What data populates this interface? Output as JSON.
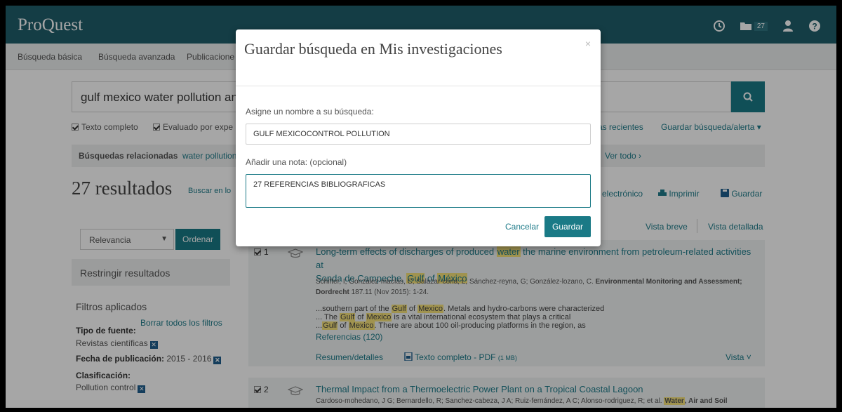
{
  "app": {
    "logo": "ProQuest",
    "folder_count": "27"
  },
  "colors": {
    "header": "#1f5f6b",
    "accent": "#1a7a86",
    "highlight": "#f6e27a"
  },
  "nav": {
    "items": [
      "Búsqueda básica",
      "Búsqueda avanzada",
      "Publicacione"
    ]
  },
  "search": {
    "query": "gulf mexico water pollution and"
  },
  "filters_row": {
    "full_text": "Texto completo",
    "peer_reviewed": "Evaluado por expe",
    "recent": "as recientes",
    "save_search": "Guardar búsqueda/alerta ▾"
  },
  "related": {
    "title": "Búsquedas relacionadas",
    "item": "water pollution",
    "see_all": "Ver todo ›"
  },
  "results": {
    "count": "27 resultados",
    "search_within": "Buscar en lo",
    "email": "electrónico",
    "print": "Imprimir",
    "save": "Guardar",
    "view_brief": "Vista breve",
    "view_detailed": "Vista detallada"
  },
  "sort": {
    "selected": "Relevancia",
    "button": "Ordenar"
  },
  "sidebar": {
    "refine_title": "Restringir resultados",
    "applied_title": "Filtros aplicados",
    "clear_all": "Borrar todos los filtros",
    "source_type_label": "Tipo de fuente:",
    "source_type_value": "Revistas científicas",
    "pub_date_label": "Fecha de publicación:",
    "pub_date_value": "2015 - 2016",
    "classification_label": "Clasificación:",
    "classification_value": "Pollution control"
  },
  "result1": {
    "number": "1",
    "title_a": "Long-term effects of discharges of produced ",
    "title_hl1": "water",
    "title_b": " the marine environment from petroleum-related activities at",
    "title_c": "Sonda de Campeche, ",
    "title_hl2": "Gulf",
    "title_d": " of ",
    "title_hl3": "México",
    "authors": "Schifter, I; González-macías, C; Salazar-coria, L; Sánchez-reyna, G; González-lozano, C.",
    "journal": "Environmental Monitoring and Assessment;",
    "journal2": "Dordrecht",
    "citation": " 187.11  (Nov 2015): 1-24.",
    "snip1_a": "...southern part of the ",
    "snip1_b": " of ",
    "snip1_c": ". Metals and hydro-carbons were characterized",
    "snip2_a": "... The ",
    "snip2_b": " of ",
    "snip2_c": " is a vital international ecosystem that plays a critical",
    "snip3_a": "...",
    "snip3_b": " of ",
    "snip3_c": ". There are about 100 oil-producing platforms in the region, as",
    "hl_gulf": "Gulf",
    "hl_mexico": "Mexico",
    "references": "Referencias (120)",
    "abstract": "Resumen/detalles",
    "pdf": "Texto completo - PDF",
    "pdf_size": "(1 MB)",
    "view": "Vista ˅"
  },
  "result2": {
    "number": "2",
    "title": "Thermal Impact from a Thermoelectric Power Plant on a Tropical Coastal Lagoon",
    "authors": "Cardoso-mohedano, J G; Bernardello, R; Sanchez-cabeza, J A; Ruiz-fernández, A C; Alonso-rodriguez, R; et al.",
    "journal_hl": "Water",
    "journal_rest": ", Air and Soil"
  },
  "modal": {
    "title": "Guardar búsqueda en Mis investigaciones",
    "close": "×",
    "name_label": "Asigne un nombre a su búsqueda:",
    "name_value": "GULF MEXICOCONTROL POLLUTION",
    "note_label": "Añadir una nota: (opcional)",
    "note_value": "27 REFERENCIAS BIBLIOGRAFICAS",
    "cancel": "Cancelar",
    "save": "Guardar"
  }
}
